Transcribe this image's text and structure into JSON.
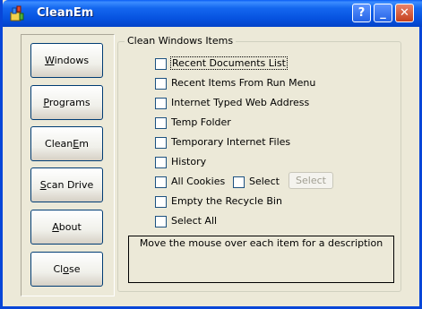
{
  "window": {
    "title": "CleanEm",
    "help_glyph": "?",
    "minimize_glyph": "_",
    "close_glyph": "✕"
  },
  "sidebar": {
    "buttons": [
      {
        "pre": "",
        "key": "W",
        "post": "indows"
      },
      {
        "pre": "",
        "key": "P",
        "post": "rograms"
      },
      {
        "pre": "Clean",
        "key": "E",
        "post": "m"
      },
      {
        "pre": "",
        "key": "S",
        "post": "can Drive"
      },
      {
        "pre": "",
        "key": "A",
        "post": "bout"
      },
      {
        "pre": "Cl",
        "key": "o",
        "post": "se"
      }
    ]
  },
  "group": {
    "title": "Clean Windows Items",
    "items": [
      {
        "label": "Recent Documents List",
        "checked": false
      },
      {
        "label": "Recent Items From Run Menu",
        "checked": false
      },
      {
        "label": "Internet Typed Web Address",
        "checked": false
      },
      {
        "label": "Temp Folder",
        "checked": false
      },
      {
        "label": "Temporary Internet Files",
        "checked": false
      },
      {
        "label": "History",
        "checked": false
      },
      {
        "label": "All Cookies",
        "checked": false
      },
      {
        "label": "Empty the Recycle Bin",
        "checked": false
      },
      {
        "label": "Select All",
        "checked": false
      }
    ],
    "select_checkbox_label": "Select",
    "select_button_label": "Select"
  },
  "description": "Move the mouse over each item for a description"
}
